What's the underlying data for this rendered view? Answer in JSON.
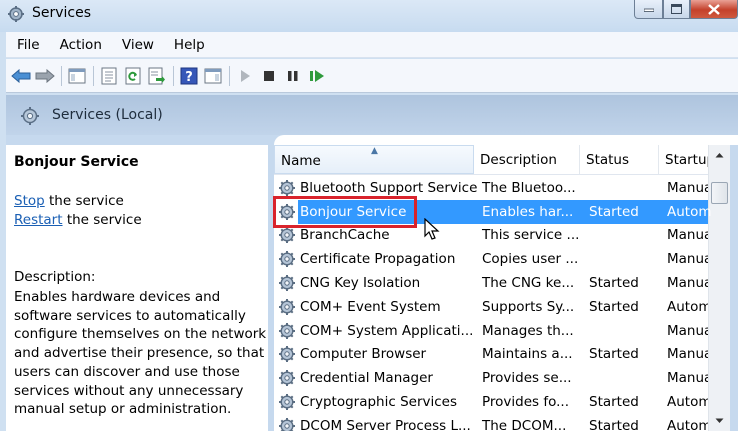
{
  "window": {
    "title": "Services"
  },
  "menu": [
    "File",
    "Action",
    "View",
    "Help"
  ],
  "band": {
    "title": "Services (Local)"
  },
  "left": {
    "service_title": "Bonjour Service",
    "stop_link": "Stop",
    "stop_rest": " the service",
    "restart_link": "Restart",
    "restart_rest": " the service",
    "description_label": "Description:",
    "description": "Enables hardware devices and software services to automatically configure themselves on the network and advertise their presence, so that users can discover and use those services without any unnecessary manual setup or administration."
  },
  "table": {
    "columns": [
      "Name",
      "Description",
      "Status",
      "Startup"
    ],
    "rows": [
      {
        "name": "Bluetooth Support Service",
        "description": "The Bluetoo...",
        "status": "",
        "startup": "Manua"
      },
      {
        "name": "Bonjour Service",
        "description": "Enables har...",
        "status": "Started",
        "startup": "Autom"
      },
      {
        "name": "BranchCache",
        "description": "This service ...",
        "status": "",
        "startup": "Manua"
      },
      {
        "name": "Certificate Propagation",
        "description": "Copies user ...",
        "status": "",
        "startup": "Manua"
      },
      {
        "name": "CNG Key Isolation",
        "description": "The CNG ke...",
        "status": "Started",
        "startup": "Manua"
      },
      {
        "name": "COM+ Event System",
        "description": "Supports Sy...",
        "status": "Started",
        "startup": "Autom"
      },
      {
        "name": "COM+ System Applicati...",
        "description": "Manages th...",
        "status": "",
        "startup": "Manua"
      },
      {
        "name": "Computer Browser",
        "description": "Maintains a...",
        "status": "Started",
        "startup": "Manua"
      },
      {
        "name": "Credential Manager",
        "description": "Provides se...",
        "status": "",
        "startup": "Manua"
      },
      {
        "name": "Cryptographic Services",
        "description": "Provides fo...",
        "status": "Started",
        "startup": "Autom"
      },
      {
        "name": "DCOM Server Process L...",
        "description": "The DCOM...",
        "status": "Started",
        "startup": "Autom"
      }
    ],
    "selected_index": 1
  },
  "colors": {
    "selection": "#3399ff",
    "highlight": "#d9232c",
    "link": "#1a5fb4"
  }
}
